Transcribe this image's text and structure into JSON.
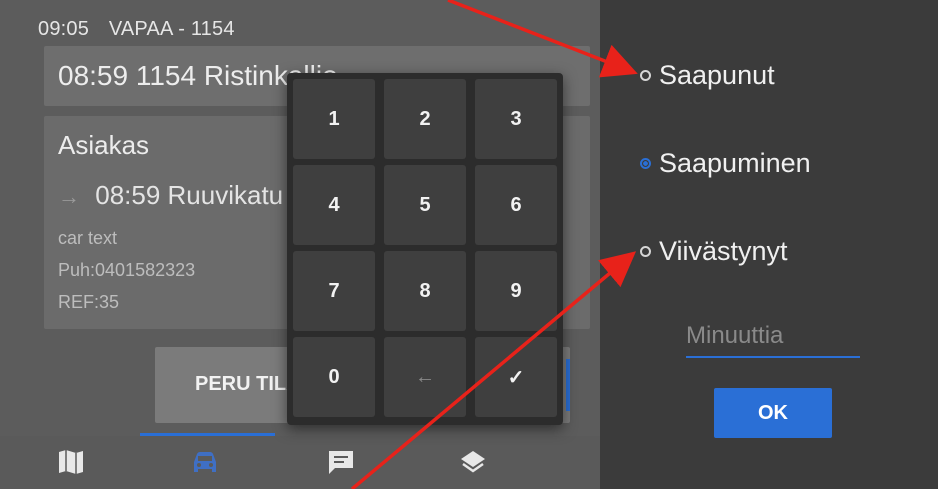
{
  "status": {
    "time": "09:05",
    "state": "VAPAA - 1154"
  },
  "trip_header": "08:59 1154 Ristinkallio",
  "card": {
    "title": "Asiakas",
    "row_text": "08:59 Ruuvikatu",
    "note1": "car text",
    "note2": "Puh:0401582323",
    "note3": "REF:35"
  },
  "peru_button": "PERU TILAUS",
  "keypad": {
    "keys": [
      "1",
      "2",
      "3",
      "4",
      "5",
      "6",
      "7",
      "8",
      "9",
      "0",
      "←",
      "✓"
    ]
  },
  "dialog": {
    "options": [
      {
        "label": "Saapunut",
        "checked": false
      },
      {
        "label": "Saapuminen",
        "checked": true
      },
      {
        "label": "Viivästynyt",
        "checked": false
      }
    ],
    "minutes_placeholder": "Minuuttia",
    "ok_label": "OK"
  },
  "nav": {
    "icons": [
      "map-icon",
      "car-icon",
      "message-icon",
      "layers-icon"
    ]
  },
  "colors": {
    "accent": "#2a6fd6",
    "annotation_arrow": "#e8221a"
  }
}
